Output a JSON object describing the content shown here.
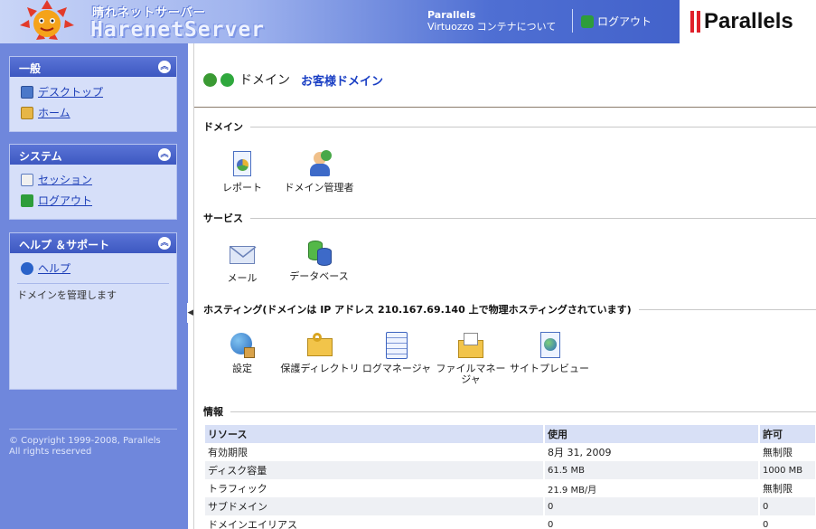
{
  "header": {
    "brand_jp": "晴れネットサーバー",
    "brand_en": "HarenetServer",
    "about_line1": "Parallels",
    "about_line2": "Virtuozzo コンテナについて",
    "logout": "ログアウト",
    "vendor": "Parallels"
  },
  "sidebar": {
    "general": {
      "title": "一般",
      "items": [
        {
          "label": "デスクトップ",
          "icon": "desktop-icon"
        },
        {
          "label": "ホーム",
          "icon": "home-icon"
        }
      ]
    },
    "system": {
      "title": "システム",
      "items": [
        {
          "label": "セッション",
          "icon": "session-icon"
        },
        {
          "label": "ログアウト",
          "icon": "logout-icon"
        }
      ]
    },
    "help": {
      "title": "ヘルプ ＆サポート",
      "items": [
        {
          "label": "ヘルプ",
          "icon": "help-icon"
        }
      ],
      "description": "ドメインを管理します"
    },
    "copyright_line1": "© Copyright 1999-2008, Parallels",
    "copyright_line2": "All rights reserved"
  },
  "main": {
    "title": "ドメイン",
    "subtitle": "お客様ドメイン",
    "sections": {
      "domain": {
        "label": "ドメイン",
        "tools": [
          "レポート",
          "ドメイン管理者"
        ]
      },
      "services": {
        "label": "サービス",
        "tools": [
          "メール",
          "データベース"
        ]
      },
      "hosting": {
        "label": "ホスティング(ドメインは IP アドレス 210.167.69.140 上で物理ホスティングされています)",
        "tools": [
          "設定",
          "保護ディレクトリ",
          "ログマネージャ",
          "ファイルマネージャ",
          "サイトプレビュー"
        ]
      },
      "info": {
        "label": "情報"
      }
    },
    "table": {
      "headers": [
        "リソース",
        "使用",
        "許可"
      ],
      "rows": [
        [
          "有効期限",
          "8月 31, 2009",
          "無制限"
        ],
        [
          "ディスク容量",
          "61.5 MB",
          "1000 MB"
        ],
        [
          "トラフィック",
          "21.9 MB/月",
          "無制限"
        ],
        [
          "サブドメイン",
          "0",
          "0"
        ],
        [
          "ドメインエイリアス",
          "0",
          "0"
        ]
      ]
    }
  },
  "colors": {
    "sidebar_bg": "#6f87dc",
    "panel_head": "#3d58c1",
    "link": "#1d3fb8",
    "accent_title": "#1a3fc4",
    "parallels_red": "#e0202a"
  }
}
